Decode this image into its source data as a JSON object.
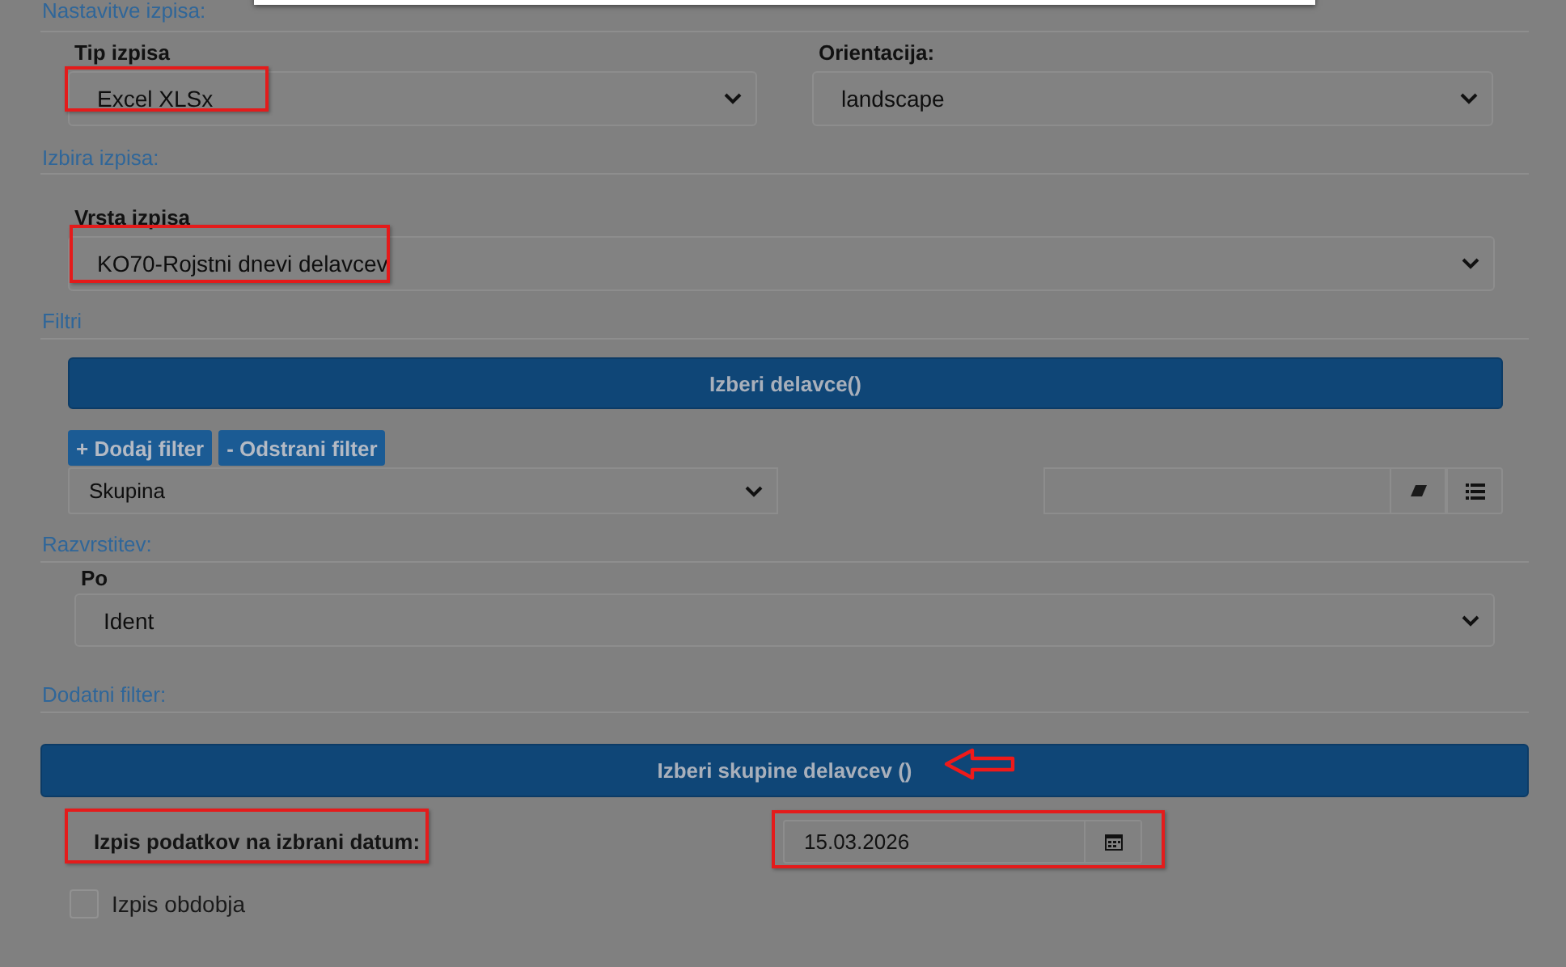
{
  "output_settings": {
    "heading": "Nastavitve izpisa:",
    "type_label": "Tip izpisa",
    "type_value": "Excel XLSx",
    "type_highlighted": true,
    "orientation_label": "Orientacija:",
    "orientation_value": "landscape"
  },
  "report_choice": {
    "heading": "Izbira izpisa:",
    "label": "Vrsta izpisa",
    "value": "KO70-Rojstni dnevi delavcev",
    "highlighted": true
  },
  "filters": {
    "heading": "Filtri",
    "select_button": "Izberi delavce()",
    "add_button": "+ Dodaj filter",
    "remove_button": "- Odstrani filter",
    "filter_field": "Skupina"
  },
  "sorting": {
    "heading": "Razvrstitev:",
    "label": "Po",
    "value": "Ident"
  },
  "extra_filter": {
    "heading": "Dodatni filter:",
    "select_button": "Izberi skupine delavcev ()",
    "button_arrow": true,
    "date_label": "Izpis podatkov na izbrani datum:",
    "date_label_highlighted": true,
    "date_value": "15.03.2026",
    "date_highlighted": true,
    "period_checkbox": {
      "label": "Izpis obdobja",
      "checked": false
    }
  }
}
